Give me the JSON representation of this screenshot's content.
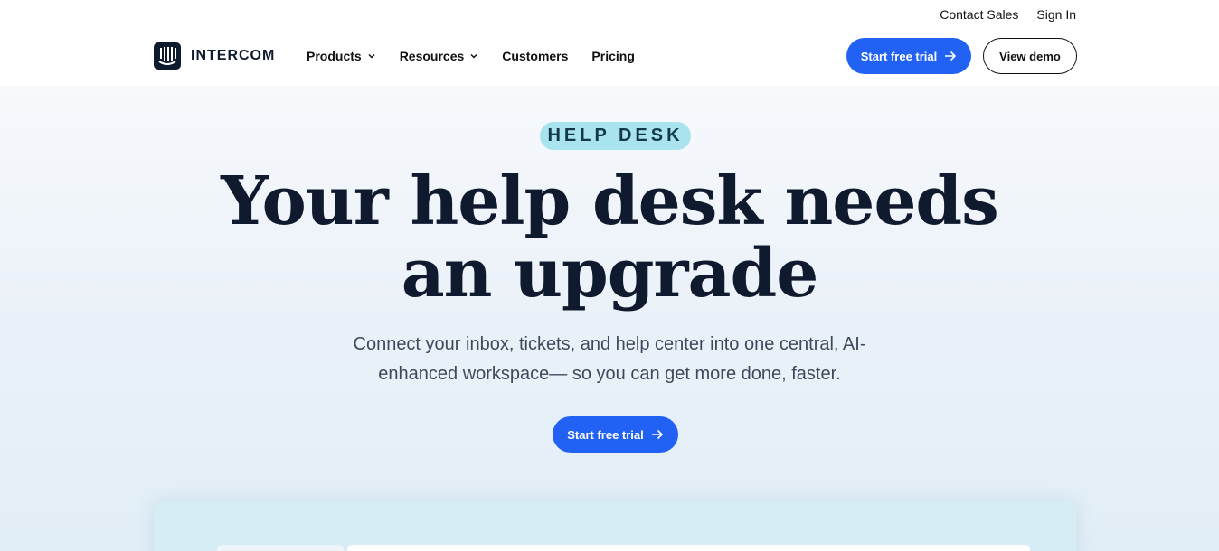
{
  "topbar": {
    "contact_sales": "Contact Sales",
    "sign_in": "Sign In"
  },
  "nav": {
    "logo_text": "INTERCOM",
    "menu": [
      {
        "label": "Products",
        "has_dropdown": true
      },
      {
        "label": "Resources",
        "has_dropdown": true
      },
      {
        "label": "Customers",
        "has_dropdown": false
      },
      {
        "label": "Pricing",
        "has_dropdown": false
      }
    ],
    "start_trial_label": "Start free trial",
    "view_demo_label": "View demo"
  },
  "hero": {
    "badge": "HELP DESK",
    "headline_line1": "Your help desk needs",
    "headline_line2": "an upgrade",
    "subtitle_line1": "Connect your inbox, tickets, and help center into one central, AI-",
    "subtitle_line2": "enhanced workspace— so you can get more done, faster.",
    "cta_label": "Start free trial"
  },
  "colors": {
    "accent": "#2162f5",
    "badge_bg": "#a8e3ee",
    "text_dark": "#0f1a2e"
  },
  "icons": {
    "logo": "intercom-logo-icon",
    "dropdown": "chevron-down-icon",
    "arrow": "arrow-right-icon"
  }
}
